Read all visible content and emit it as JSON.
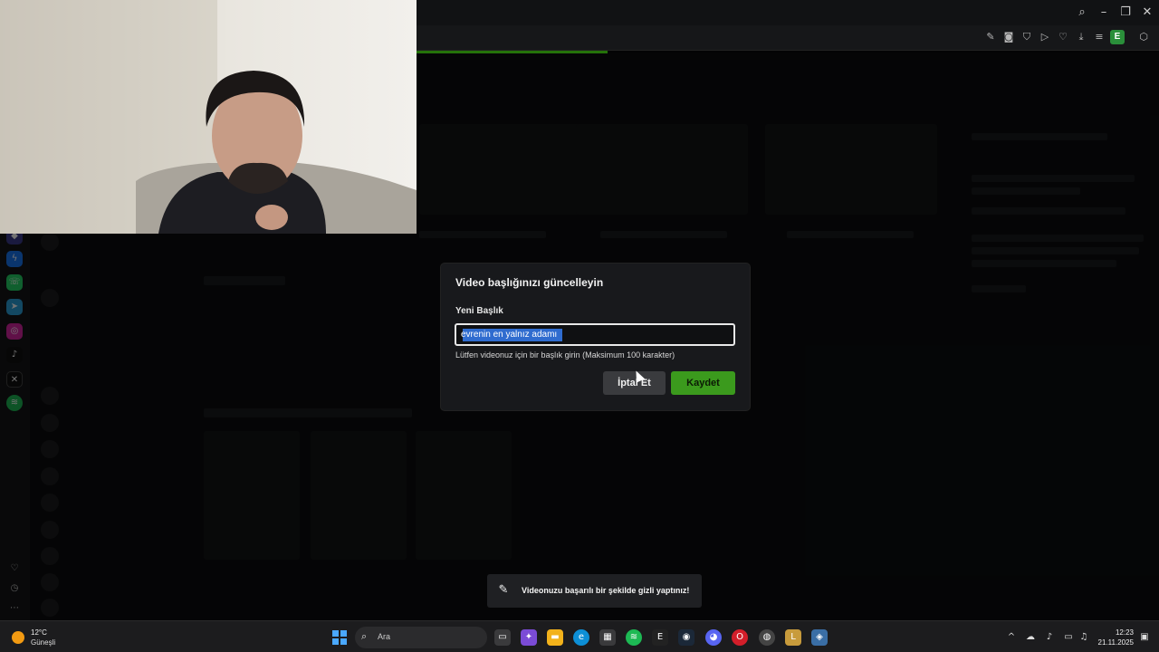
{
  "modal": {
    "title": "Video başlığınızı güncelleyin",
    "field_label": "Yeni Başlık",
    "input_value": "evrenin en yalnız adamı",
    "hint": "Lütfen videonuz için bir başlık girin (Maksimum 100 karakter)",
    "cancel_label": "İptal Et",
    "save_label": "Kaydet"
  },
  "toast": {
    "message": "Videonuzu başarılı bir şekilde gizli yaptınız!"
  },
  "taskbar": {
    "weather_temp": "12°C",
    "weather_condition": "Güneşli",
    "search_label": "Ara",
    "time": "12:23",
    "date": "21.11.2025"
  },
  "colors": {
    "accent": "#53fc18",
    "save_button": "#3b9a1d",
    "selection": "#2f6ccf"
  }
}
